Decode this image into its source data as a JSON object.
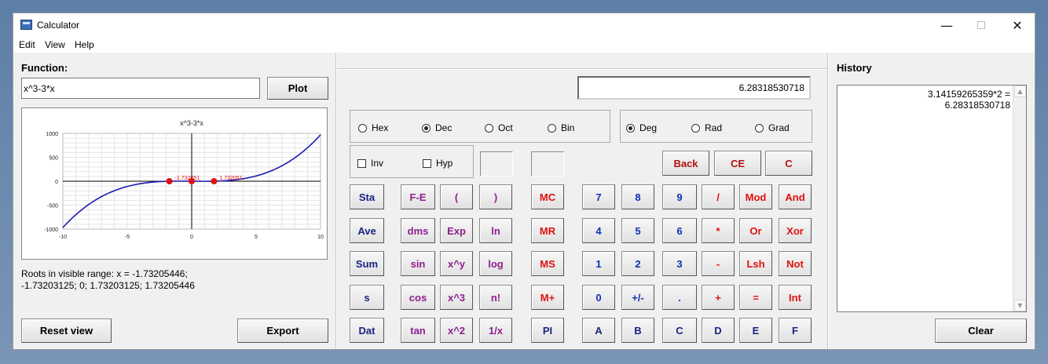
{
  "window": {
    "title": "Calculator",
    "minimize_icon": "minimize-icon",
    "maximize_icon": "maximize-icon",
    "close_icon": "close-icon"
  },
  "menu": {
    "edit": "Edit",
    "view": "View",
    "help": "Help"
  },
  "function_panel": {
    "label": "Function:",
    "input_value": "x^3-3*x",
    "plot_button": "Plot",
    "roots_line1": "Roots in visible range: x = -1.73205446;",
    "roots_line2": "-1.73203125; 0; 1.73203125; 1.73205446",
    "reset_button": "Reset view",
    "export_button": "Export"
  },
  "chart_data": {
    "type": "line",
    "title": "x^3-3*x",
    "xlim": [
      -10,
      10
    ],
    "ylim": [
      -1000,
      1000
    ],
    "x_ticks": [
      "-10",
      "-5",
      "0",
      "5",
      "10"
    ],
    "y_ticks": [
      "1000",
      "500",
      "0",
      "-500",
      "-1000"
    ],
    "grid": true,
    "line_color": "#1a1ab0",
    "root_color": "#e01010",
    "root_labels": [
      "-1.732051",
      "1.732051"
    ],
    "root_points": [
      {
        "x": -1.73205,
        "y": 0
      },
      {
        "x": 0,
        "y": 0
      },
      {
        "x": 1.73205,
        "y": 0
      }
    ]
  },
  "calc": {
    "display": "6.28318530718",
    "base": {
      "hex": "Hex",
      "dec": "Dec",
      "oct": "Oct",
      "bin": "Bin",
      "selected": "Dec"
    },
    "angle": {
      "deg": "Deg",
      "rad": "Rad",
      "grad": "Grad",
      "selected": "Deg"
    },
    "inv": "Inv",
    "hyp": "Hyp",
    "back": "Back",
    "ce": "CE",
    "c": "C",
    "keys": {
      "sta": "Sta",
      "ave": "Ave",
      "sum": "Sum",
      "s": "s",
      "dat": "Dat",
      "fe": "F-E",
      "dms": "dms",
      "sin": "sin",
      "cos": "cos",
      "tan": "tan",
      "lparen": "(",
      "exp": "Exp",
      "xpowy": "x^y",
      "xcube": "x^3",
      "xsq": "x^2",
      "rparen": ")",
      "ln": "ln",
      "log": "log",
      "fact": "n!",
      "recip": "1/x",
      "mc": "MC",
      "mr": "MR",
      "ms": "MS",
      "mplus": "M+",
      "pi": "PI",
      "n7": "7",
      "n4": "4",
      "n1": "1",
      "n0": "0",
      "a": "A",
      "n8": "8",
      "n5": "5",
      "n2": "2",
      "neg": "+/-",
      "b": "B",
      "n9": "9",
      "n6": "6",
      "n3": "3",
      "dot": ".",
      "hc": "C",
      "div": "/",
      "mul": "*",
      "sub": "-",
      "add": "+",
      "d": "D",
      "mod": "Mod",
      "or": "Or",
      "lsh": "Lsh",
      "eq": "=",
      "e": "E",
      "and": "And",
      "xor": "Xor",
      "not": "Not",
      "int": "Int",
      "f": "F"
    }
  },
  "history": {
    "label": "History",
    "entry_expr": "3.14159265359*2 =",
    "entry_result": "6.28318530718",
    "clear_button": "Clear"
  }
}
